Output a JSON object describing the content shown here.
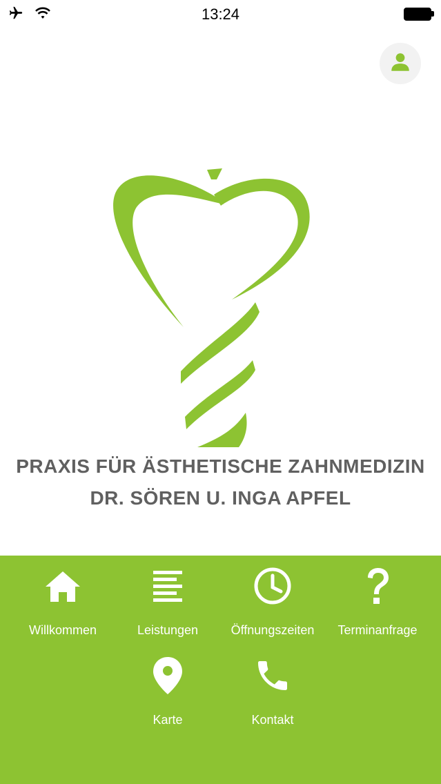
{
  "status_bar": {
    "time": "13:24"
  },
  "brand": {
    "accent": "#8dc332",
    "title_line1": "PRAXIS FÜR ÄSTHETISCHE ZAHNMEDIZIN",
    "title_line2": "DR. SÖREN U. INGA APFEL"
  },
  "nav": {
    "items": [
      {
        "label": "Willkommen",
        "icon": "home-icon"
      },
      {
        "label": "Leistungen",
        "icon": "list-icon"
      },
      {
        "label": "Öffnungszeiten",
        "icon": "clock-icon"
      },
      {
        "label": "Terminanfrage",
        "icon": "question-icon"
      },
      {
        "label": "Karte",
        "icon": "map-pin-icon"
      },
      {
        "label": "Kontakt",
        "icon": "phone-icon"
      }
    ]
  }
}
